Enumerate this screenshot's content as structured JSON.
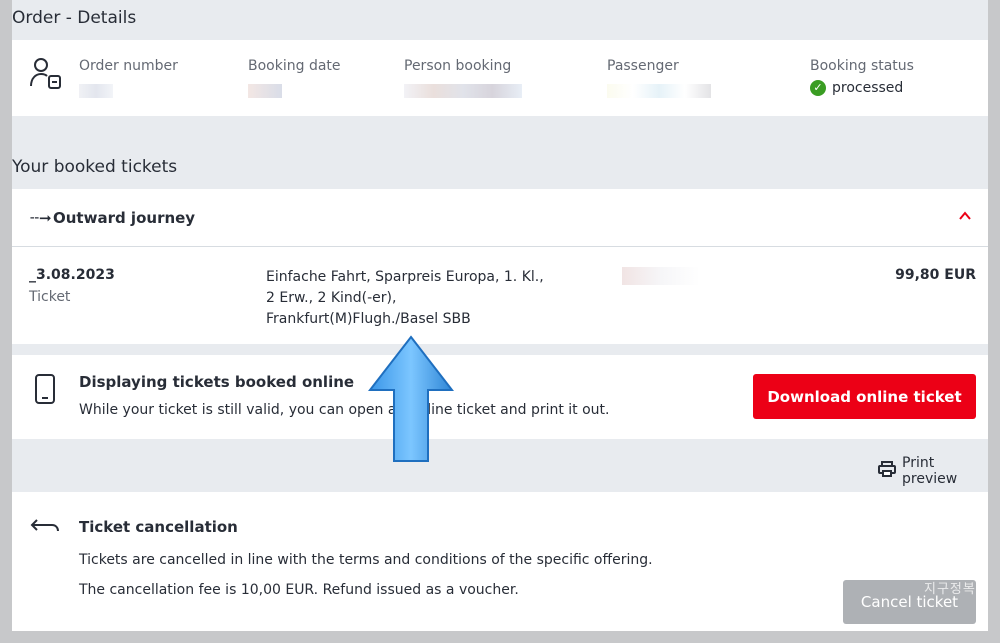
{
  "page": {
    "title": "Order - Details",
    "tickets_heading": "Your booked tickets"
  },
  "order": {
    "order_number_label": "Order number",
    "booking_date_label": "Booking date",
    "person_booking_label": "Person booking",
    "passenger_label": "Passenger",
    "booking_status_label": "Booking status",
    "booking_status_value": "processed"
  },
  "journey": {
    "title": "Outward journey",
    "date": "_3.08.2023",
    "type_label": "Ticket",
    "description_line1": "Einfache Fahrt, Sparpreis Europa, 1. Kl.,",
    "description_line2": "2 Erw., 2 Kind(-er),",
    "description_line3": "Frankfurt(M)Flugh./Basel SBB",
    "price": "99,80 EUR"
  },
  "online_ticket": {
    "title": "Displaying tickets booked online",
    "text": "While your ticket is still valid, you can open an online ticket and print it out.",
    "download_button": "Download online ticket"
  },
  "print": {
    "label": "Print preview"
  },
  "cancellation": {
    "title": "Ticket cancellation",
    "text1": "Tickets are cancelled in line with the terms and conditions of the specific offering.",
    "text2": "The cancellation fee is 10,00 EUR. Refund issued as a voucher.",
    "cancel_button": "Cancel ticket"
  },
  "watermark": "지구정복",
  "colors": {
    "accent_red": "#ec0016",
    "success_green": "#3a9d23",
    "disabled_grey": "#aeb1b5",
    "highlight_arrow": "#4aa8f0"
  },
  "icons": {
    "person_booking": "person-ticket-icon",
    "check": "check-circle-icon",
    "arrow_right": "arrow-right-icon",
    "chevron_up": "chevron-up-icon",
    "phone": "smartphone-icon",
    "printer": "printer-icon",
    "cancel": "return-arrow-icon",
    "highlight": "up-arrow-icon"
  }
}
